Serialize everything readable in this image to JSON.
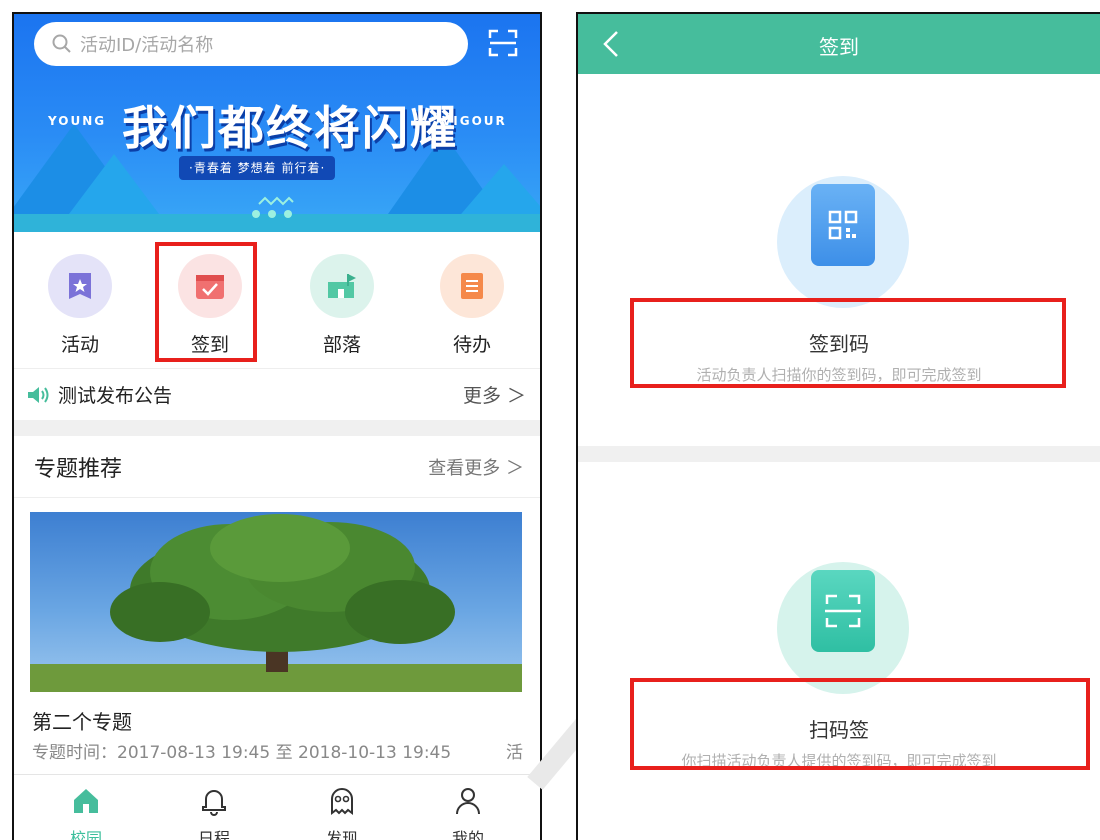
{
  "left": {
    "search": {
      "placeholder": "活动ID/活动名称"
    },
    "banner": {
      "side_left": "YOUNG",
      "side_right": "VIGOUR",
      "title": "我们都终将闪耀",
      "subtitle": "·青春着 梦想着 前行着·"
    },
    "quick": [
      {
        "label": "活动",
        "icon": "ticket-icon",
        "bg": "#e4e3f8"
      },
      {
        "label": "签到",
        "icon": "calendar-check-icon",
        "bg": "#fbe3e3"
      },
      {
        "label": "部落",
        "icon": "tribe-flag-icon",
        "bg": "#dcf3ec"
      },
      {
        "label": "待办",
        "icon": "todo-list-icon",
        "bg": "#fde6d8"
      }
    ],
    "notice": {
      "text": "测试发布公告",
      "more": "更多 ＞"
    },
    "section": {
      "title": "专题推荐",
      "more": "查看更多 ＞"
    },
    "topic": {
      "title": "第二个专题",
      "meta": "专题时间：2017-08-13 19:45 至 2018-10-13 19:45",
      "meta_extra": "活"
    },
    "tabs": [
      {
        "label": "校园",
        "icon": "home-icon",
        "active": true
      },
      {
        "label": "日程",
        "icon": "bell-icon",
        "active": false
      },
      {
        "label": "发现",
        "icon": "ghost-icon",
        "active": false
      },
      {
        "label": "我的",
        "icon": "user-icon",
        "active": false
      }
    ]
  },
  "right": {
    "header": {
      "title": "签到"
    },
    "options": [
      {
        "label": "签到码",
        "desc": "活动负责人扫描你的签到码，即可完成签到",
        "icon": "qr-code-icon"
      },
      {
        "label": "扫码签",
        "desc": "你扫描活动负责人提供的签到码，即可完成签到",
        "icon": "scan-icon"
      }
    ]
  },
  "colors": {
    "accent": "#46bd9c",
    "highlight": "#e8201c",
    "banner": "#1b74f0"
  }
}
